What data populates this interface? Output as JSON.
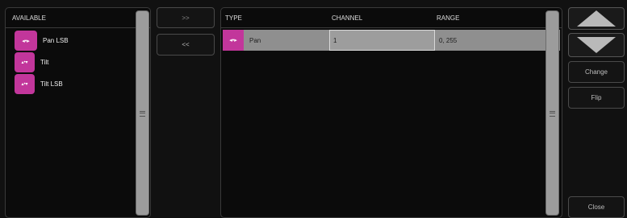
{
  "available": {
    "header": "AVAILABLE",
    "items": [
      {
        "label": "Pan LSB",
        "icon": "pan-icon",
        "glyph": "◂•▸"
      },
      {
        "label": "Tilt",
        "icon": "tilt-icon",
        "glyph": "▴•▾"
      },
      {
        "label": "Tilt LSB",
        "icon": "tilt-icon",
        "glyph": "▴•▾"
      }
    ]
  },
  "transfer": {
    "add_label": ">>",
    "remove_label": "<<"
  },
  "channels": {
    "headers": {
      "type": "TYPE",
      "channel": "CHANNEL",
      "range": "RANGE"
    },
    "rows": [
      {
        "type": "Pan",
        "icon": "pan-icon",
        "glyph": "◂•▸",
        "channel": "1",
        "range": "0, 255"
      }
    ]
  },
  "actions": {
    "change_label": "Change",
    "flip_label": "Flip",
    "close_label": "Close"
  },
  "colors": {
    "accent": "#c2369b",
    "selected_row": "#8f8f8f",
    "background": "#111111"
  }
}
